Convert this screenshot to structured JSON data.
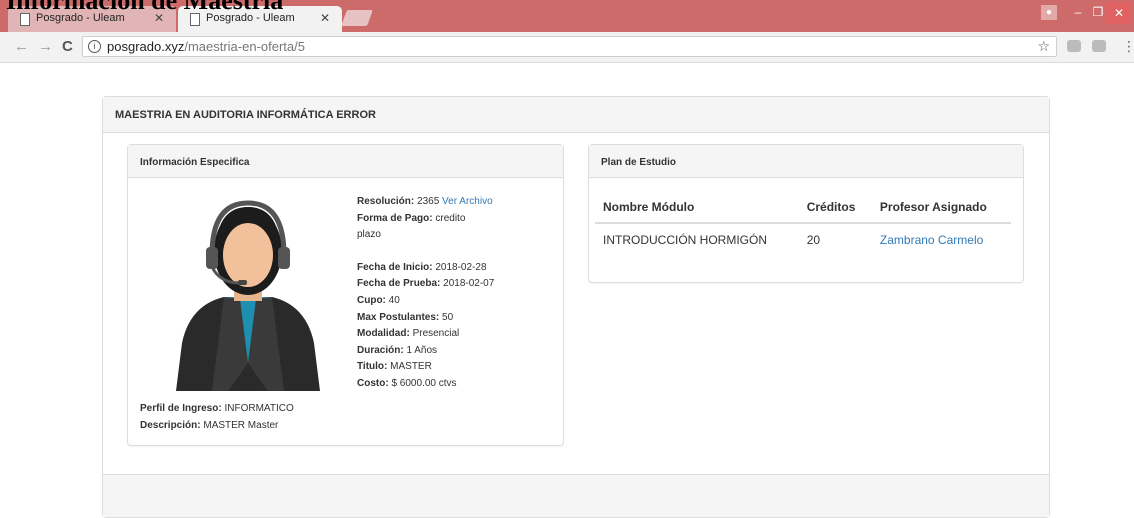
{
  "page_heading": "Información de Maestría",
  "browser": {
    "tabs": [
      {
        "title": "Posgrado - Uleam"
      },
      {
        "title": "Posgrado - Uleam"
      }
    ],
    "url_host": "posgrado.xyz",
    "url_path": "/maestria-en-oferta/5"
  },
  "program": {
    "title": "MAESTRIA EN AUDITORIA INFORMÁTICA ERROR"
  },
  "info_panel": {
    "heading": "Información Especifica",
    "resolucion_label": "Resolución:",
    "resolucion_value": "2365",
    "ver_archivo": "Ver Archivo",
    "forma_pago_label": "Forma de Pago:",
    "forma_pago_value": "credito",
    "forma_pago_value2": "plazo",
    "fecha_inicio_label": "Fecha de Inicio:",
    "fecha_inicio_value": "2018-02-28",
    "fecha_prueba_label": "Fecha de Prueba:",
    "fecha_prueba_value": "2018-02-07",
    "cupo_label": "Cupo:",
    "cupo_value": "40",
    "max_post_label": "Max Postulantes:",
    "max_post_value": "50",
    "modalidad_label": "Modalidad:",
    "modalidad_value": "Presencial",
    "duracion_label": "Duración:",
    "duracion_value": "1 Años",
    "titulo_label": "Titulo:",
    "titulo_value": "MASTER",
    "costo_label": "Costo:",
    "costo_value": "$ 6000.00 ctvs",
    "perfil_label": "Perfil de Ingreso:",
    "perfil_value": "INFORMATICO",
    "descripcion_label": "Descripción:",
    "descripcion_value": "MASTER Master"
  },
  "plan_panel": {
    "heading": "Plan de Estudio",
    "columns": [
      "Nombre Módulo",
      "Créditos",
      "Profesor Asignado"
    ],
    "rows": [
      {
        "modulo": "INTRODUCCIÓN HORMIGÓN",
        "creditos": "20",
        "profesor": "Zambrano Carmelo"
      }
    ]
  },
  "colors": {
    "tabbar": "#cd6b6b",
    "link": "#337ab7",
    "panel_heading_bg": "#f5f5f5"
  },
  "icons": [
    "document-icon",
    "close-icon",
    "info-icon",
    "star-icon",
    "user-icon",
    "menu-icon"
  ]
}
